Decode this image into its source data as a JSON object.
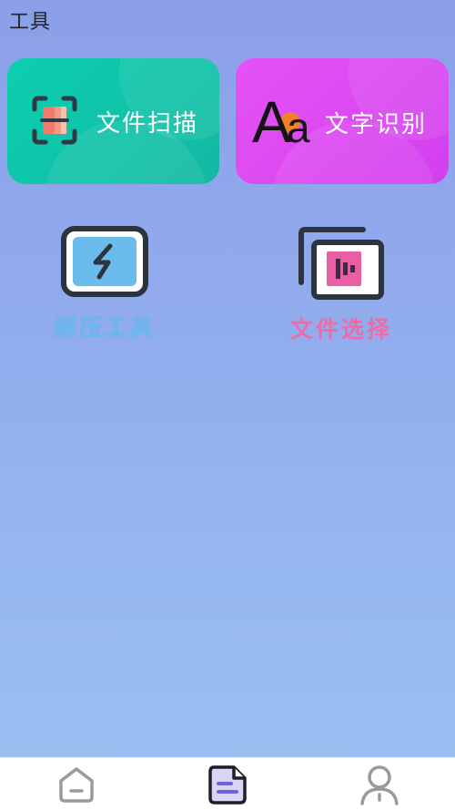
{
  "header": {
    "title": "工具"
  },
  "cards": [
    {
      "label": "文件扫描",
      "icon": "scan-icon",
      "color": "#13c2a7"
    },
    {
      "label": "文字识别",
      "icon": "text-recognition-icon",
      "glyph": "Aa",
      "color": "#dd48f2"
    }
  ],
  "tools": [
    {
      "label": "解压工具",
      "icon": "lightning-icon",
      "color": "#6bb8ee"
    },
    {
      "label": "文件选择",
      "icon": "file-select-icon",
      "color": "#f06aa6"
    }
  ],
  "tabbar": {
    "tabs": [
      {
        "icon": "home-icon",
        "active": false
      },
      {
        "icon": "document-icon",
        "active": true
      },
      {
        "icon": "user-icon",
        "active": false
      }
    ]
  },
  "colors": {
    "accent": "#6a66d8",
    "inactive": "#9a9a9a"
  }
}
